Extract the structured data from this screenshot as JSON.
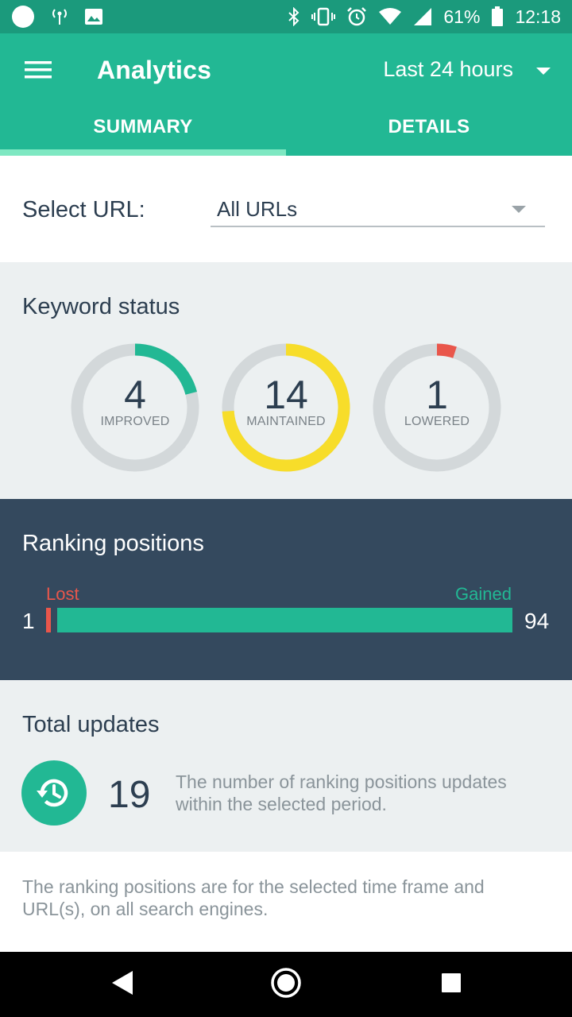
{
  "status_bar": {
    "battery": "61%",
    "time": "12:18",
    "left_icons": [
      "circle-icon",
      "antenna-icon",
      "image-icon"
    ],
    "right_icons": [
      "bluetooth-icon",
      "vibrate-icon",
      "alarm-icon",
      "wifi-icon",
      "signal-icon",
      "battery-icon"
    ]
  },
  "app_bar": {
    "title": "Analytics",
    "range": "Last 24 hours",
    "tabs": [
      {
        "label": "SUMMARY",
        "active": true
      },
      {
        "label": "DETAILS",
        "active": false
      }
    ],
    "color": "#22b894"
  },
  "url_filter": {
    "label": "Select URL:",
    "value": "All URLs"
  },
  "keyword_status": {
    "title": "Keyword status",
    "rings": [
      {
        "value": "4",
        "label": "IMPROVED",
        "fraction": 0.21,
        "color": "#22b894"
      },
      {
        "value": "14",
        "label": "MAINTAINED",
        "fraction": 0.74,
        "color": "#f7dd2a"
      },
      {
        "value": "1",
        "label": "LOWERED",
        "fraction": 0.05,
        "color": "#e9564b"
      }
    ]
  },
  "ranking_positions": {
    "title": "Ranking positions",
    "lost_label": "Lost",
    "gained_label": "Gained",
    "lost_value": "1",
    "gained_value": "94",
    "lost_color": "#e9564b",
    "gained_color": "#22b894"
  },
  "total_updates": {
    "title": "Total updates",
    "count": "19",
    "description": "The number of ranking positions updates within the selected period.",
    "icon": "history-icon"
  },
  "footnote": "The ranking positions are for the selected time frame and URL(s), on all search engines.",
  "nav_bar": {
    "buttons": [
      "back-icon",
      "home-icon",
      "recents-icon"
    ]
  }
}
